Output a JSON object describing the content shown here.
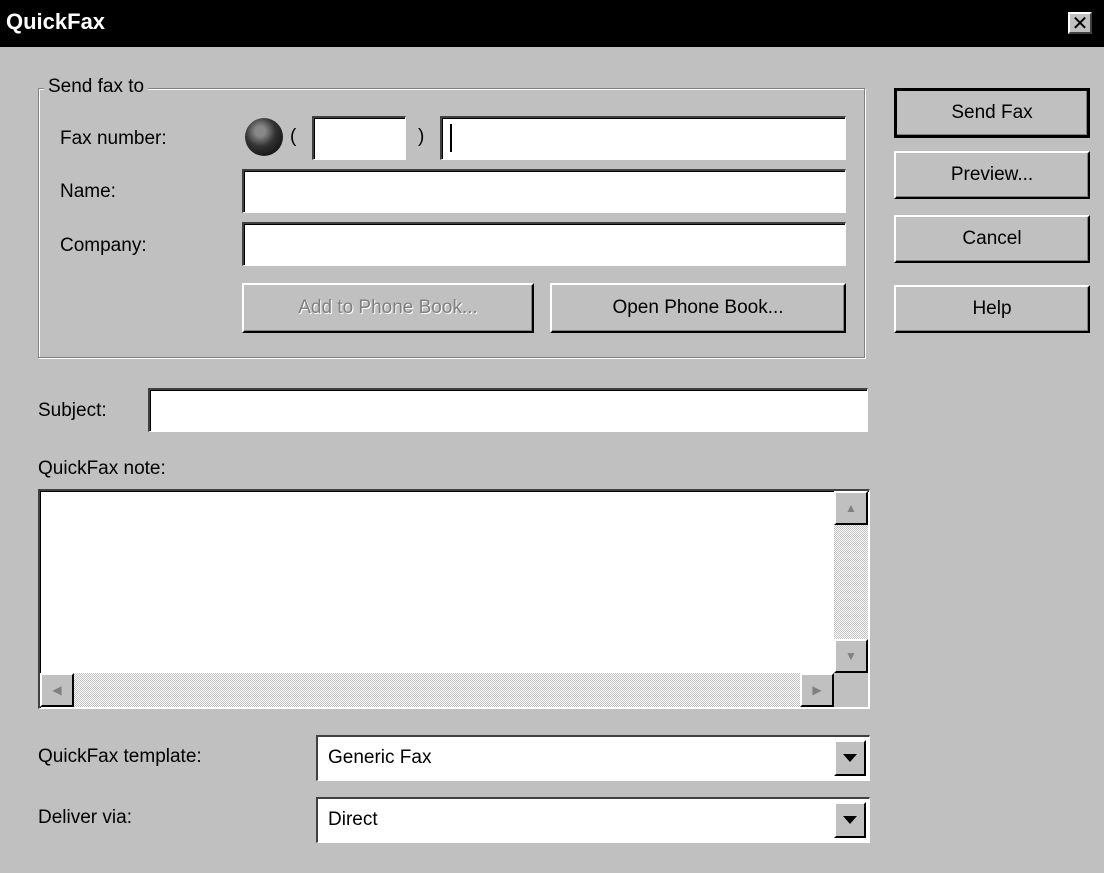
{
  "window": {
    "title": "QuickFax",
    "close_glyph": "✕"
  },
  "send_group": {
    "label": "Send fax to",
    "fax_label": "Fax number:",
    "name_label": "Name:",
    "company_label": "Company:",
    "area_open": "(",
    "area_close": ")",
    "area_code": "",
    "fax_number": "",
    "name": "",
    "company": "",
    "add_button": "Add to Phone Book...",
    "open_button": "Open Phone Book..."
  },
  "subject": {
    "label": "Subject:",
    "value": ""
  },
  "note": {
    "label": "QuickFax note:",
    "value": ""
  },
  "template": {
    "label": "QuickFax template:",
    "value": "Generic Fax"
  },
  "deliver": {
    "label": "Deliver via:",
    "value": "Direct"
  },
  "buttons": {
    "send": "Send Fax",
    "preview": "Preview...",
    "cancel": "Cancel",
    "help": "Help"
  },
  "icons": {
    "globe": "globe-icon",
    "dropdown": "chevron-down-icon"
  },
  "colors": {
    "titlebar": "#000000",
    "face": "#c0c0c0",
    "field": "#ffffff",
    "disabled_text": "#808080"
  }
}
